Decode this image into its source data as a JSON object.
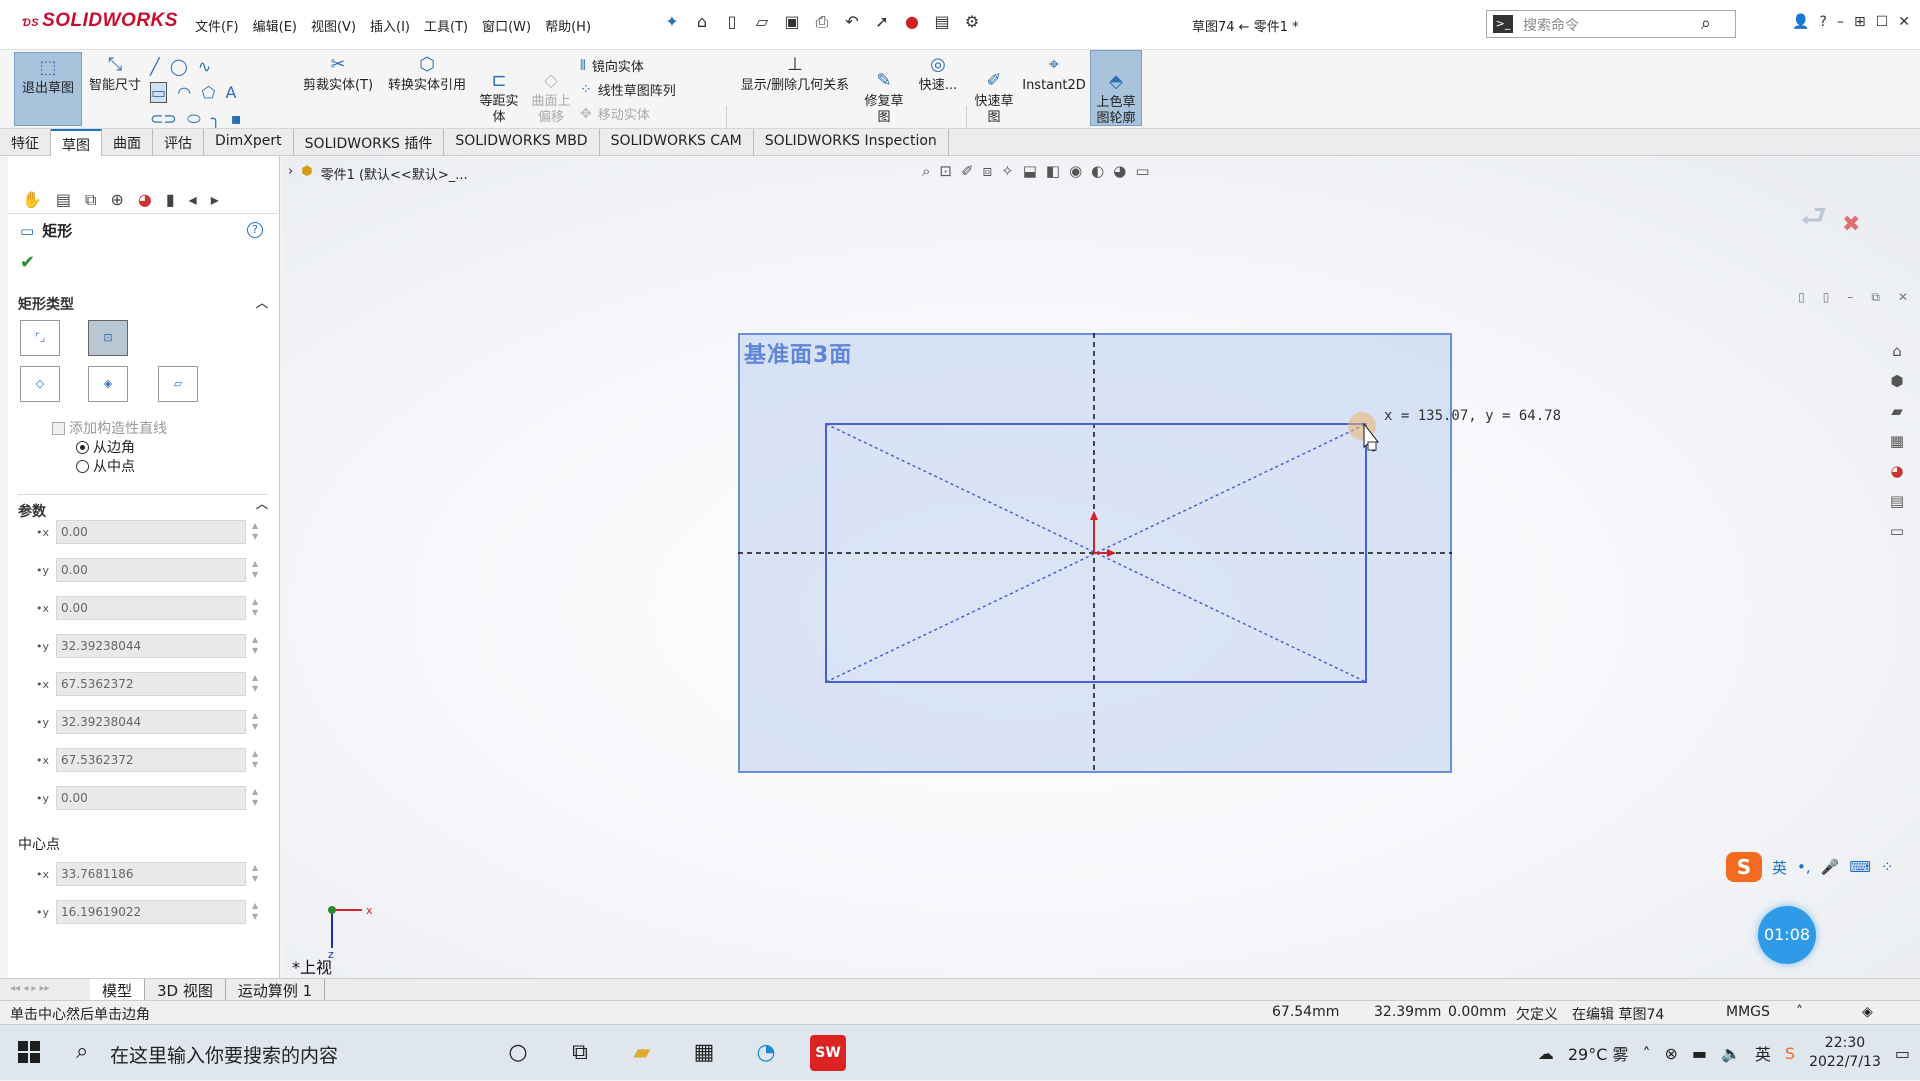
{
  "app": {
    "logo": "SOLIDWORKS",
    "doc_title": "草图74 ← 零件1 *"
  },
  "menu": [
    "文件(F)",
    "编辑(E)",
    "视图(V)",
    "插入(I)",
    "工具(T)",
    "窗口(W)",
    "帮助(H)"
  ],
  "search": {
    "placeholder": "搜索命令"
  },
  "ribbon": {
    "exit_sketch": "退出草图",
    "smart_dim": "智能尺寸",
    "trim": "剪裁实体(T)",
    "convert": "转换实体引用",
    "offset": "等距实\n体",
    "surface_offset": "曲面上\n偏移",
    "mirror": "镜向实体",
    "linear_pattern": "线性草图阵列",
    "move": "移动实体",
    "show_relations": "显示/删除几何关系",
    "repair": "修复草\n图",
    "quick_snaps": "快速...",
    "quick_sketch": "快速草\n图",
    "instant2d": "Instant2D",
    "shaded_sketch": "上色草\n图轮廓"
  },
  "tabs": [
    "特征",
    "草图",
    "曲面",
    "评估",
    "DimXpert",
    "SOLIDWORKS 插件",
    "SOLIDWORKS MBD",
    "SOLIDWORKS CAM",
    "SOLIDWORKS Inspection"
  ],
  "active_tab": "草图",
  "property_manager": {
    "title": "矩形",
    "rect_type_header": "矩形类型",
    "add_construction": "添加构造性直线",
    "from_corner": "从边角",
    "from_mid": "从中点",
    "params_header": "参数",
    "params": [
      {
        "axis": "x",
        "value": "0.00"
      },
      {
        "axis": "y",
        "value": "0.00"
      },
      {
        "axis": "x",
        "value": "0.00"
      },
      {
        "axis": "y",
        "value": "32.39238044"
      },
      {
        "axis": "x",
        "value": "67.5362372"
      },
      {
        "axis": "y",
        "value": "32.39238044"
      },
      {
        "axis": "x",
        "value": "67.5362372"
      },
      {
        "axis": "y",
        "value": "0.00"
      }
    ],
    "center_header": "中心点",
    "center": [
      {
        "axis": "x",
        "value": "33.7681186"
      },
      {
        "axis": "y",
        "value": "16.19619022"
      }
    ]
  },
  "canvas": {
    "breadcrumb": "零件1 (默认<<默认>_...",
    "plane_label": "基准面3面",
    "coord_readout": "x = 135.07,  y = 64.78",
    "view_label": "*上视",
    "timer": "01:08"
  },
  "bottom_tabs": [
    "模型",
    "3D 视图",
    "运动算例 1"
  ],
  "status": {
    "hint": "单击中心然后单击边角",
    "dim1": "67.54mm",
    "dim2": "32.39mm",
    "dim3": "0.00mm",
    "state": "欠定义",
    "editing": "在编辑 草图74",
    "units": "MMGS"
  },
  "taskbar": {
    "search_placeholder": "在这里输入你要搜索的内容",
    "weather": "29°C 雾",
    "time": "22:30",
    "date": "2022/7/13",
    "ime": "英"
  }
}
